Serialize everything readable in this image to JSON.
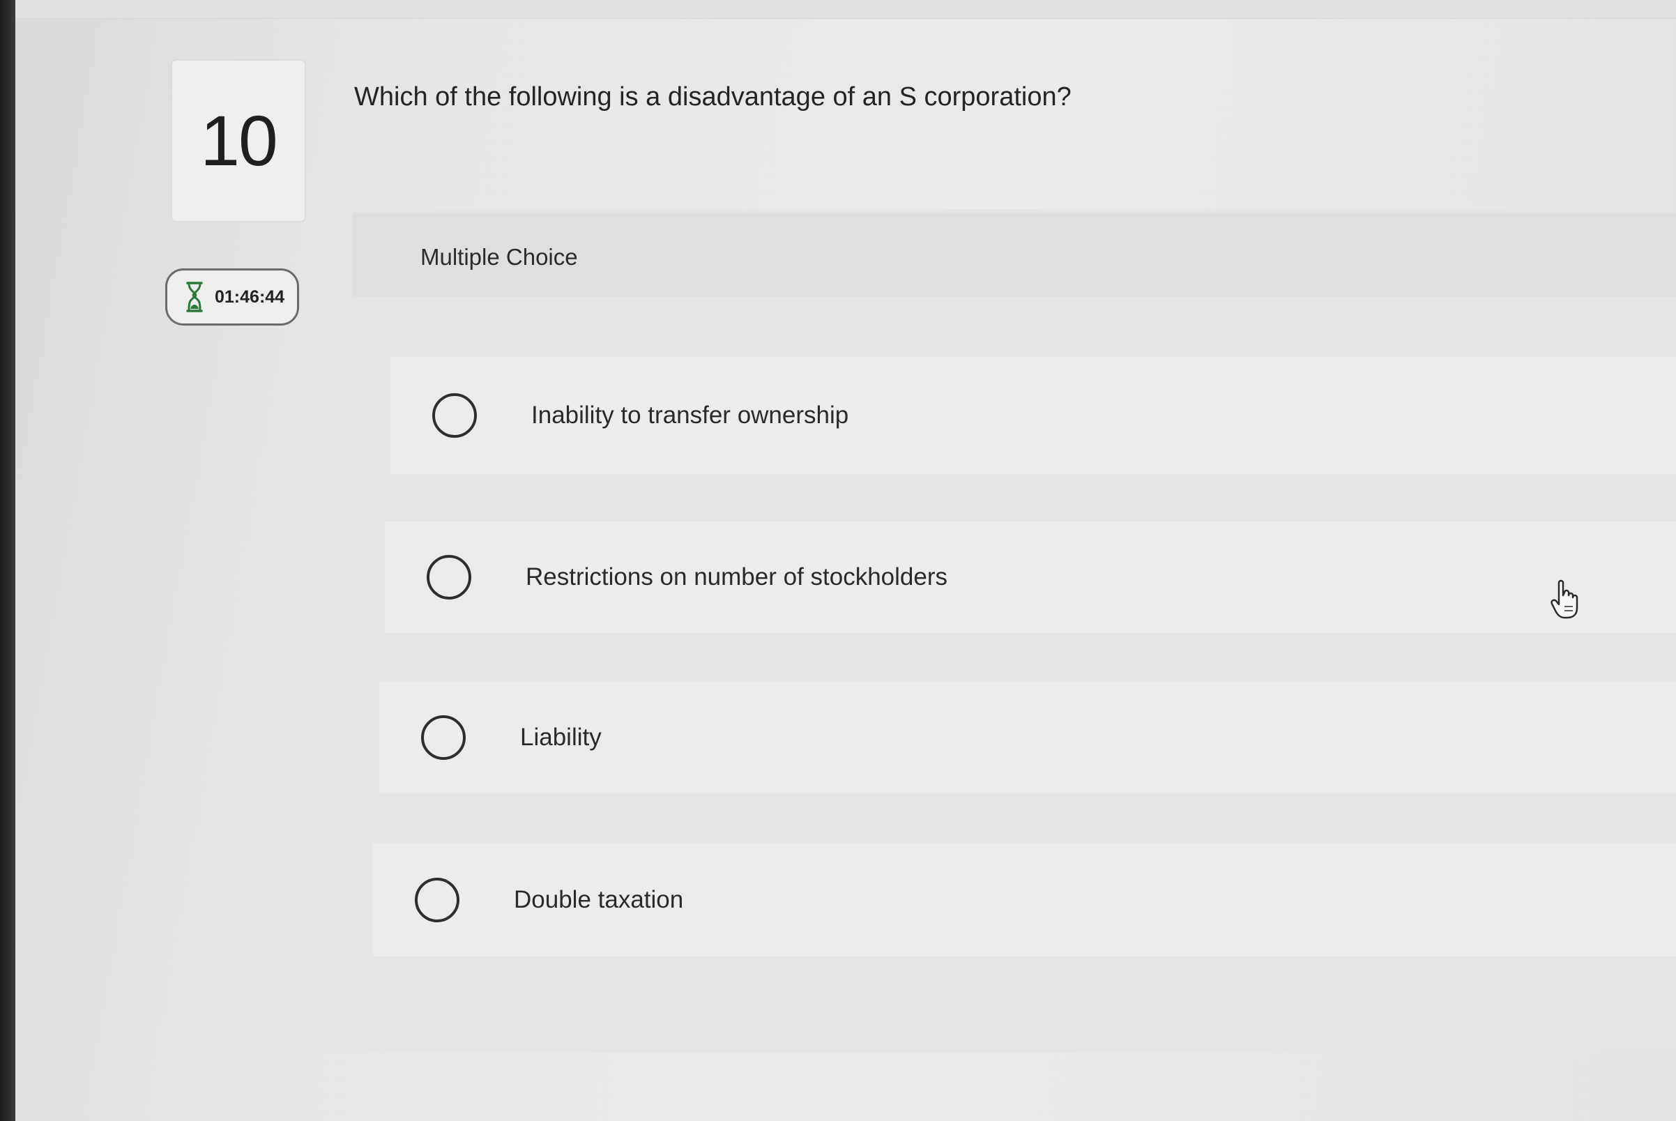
{
  "question": {
    "number": "10",
    "text": "Which of the following is a disadvantage of an S corporation?",
    "type_label": "Multiple Choice"
  },
  "timer": {
    "value": "01:46:44",
    "icon": "hourglass-icon"
  },
  "options": [
    {
      "label": "Inability to transfer ownership",
      "selected": false
    },
    {
      "label": "Restrictions on number of stockholders",
      "selected": false
    },
    {
      "label": "Liability",
      "selected": false
    },
    {
      "label": "Double taxation",
      "selected": false
    }
  ],
  "cursor": {
    "icon": "hand-pointer-icon"
  }
}
